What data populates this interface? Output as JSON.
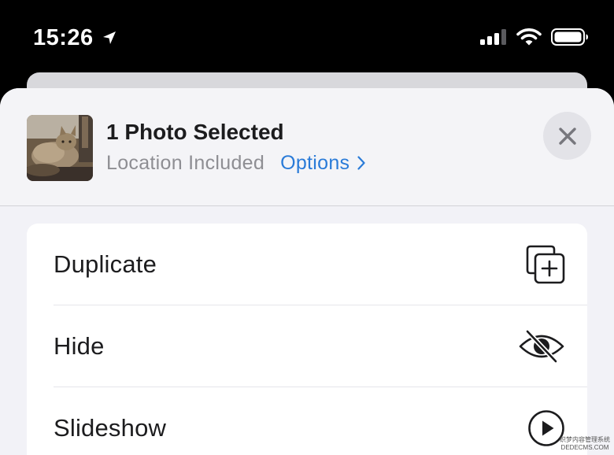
{
  "status_bar": {
    "time": "15:26",
    "icons": [
      "location-arrow-icon",
      "cellular-signal-icon",
      "wifi-icon",
      "battery-icon"
    ]
  },
  "sheet": {
    "title": "1 Photo Selected",
    "subtitle": "Location Included",
    "options_label": "Options",
    "thumbnail_subject": "cat-photo",
    "close_icon": "close-icon"
  },
  "actions": [
    {
      "label": "Duplicate",
      "icon": "duplicate-icon"
    },
    {
      "label": "Hide",
      "icon": "eye-slash-icon"
    },
    {
      "label": "Slideshow",
      "icon": "play-circle-icon"
    }
  ],
  "colors": {
    "link": "#2a7bd8",
    "sheet_background": "#f2f2f7",
    "secondary_text": "#8e8e93"
  },
  "watermark": {
    "line1": "织梦内容管理系统",
    "line2": "DEDECMS.COM"
  }
}
